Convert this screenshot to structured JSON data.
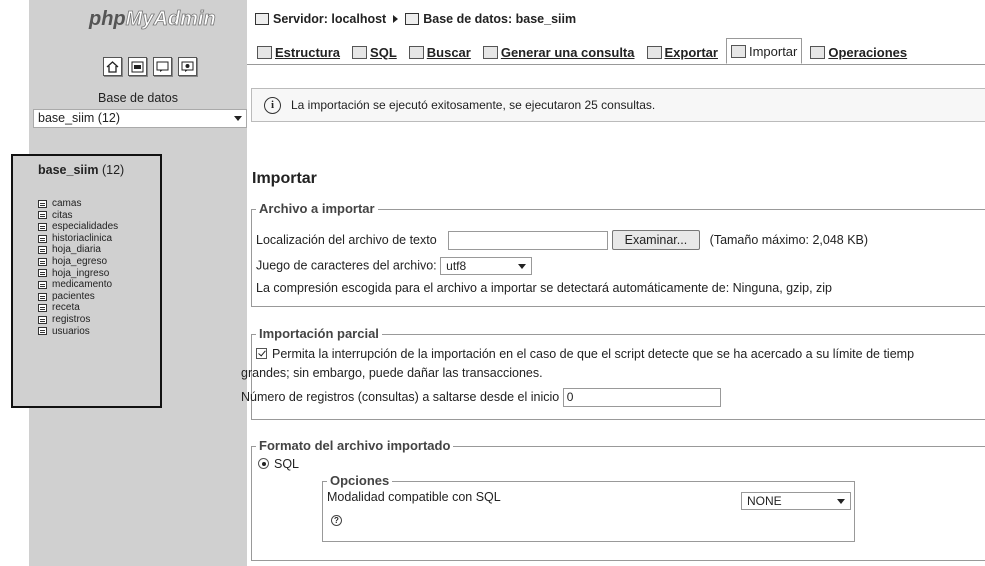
{
  "sidebar": {
    "logo_php": "php",
    "logo_my": "MyAdmin",
    "icon_buttons": [
      "home-icon",
      "sql-icon",
      "help-icon",
      "query-window-icon"
    ],
    "db_label": "Base de datos",
    "db_select_value": "base_siim (12)",
    "db_name": "base_siim",
    "db_count": "(12)",
    "tables": [
      "camas",
      "citas",
      "especialidades",
      "historiaclinica",
      "hoja_diaria",
      "hoja_egreso",
      "hoja_ingreso",
      "medicamento",
      "pacientes",
      "receta",
      "registros",
      "usuarios"
    ]
  },
  "breadcrumb": {
    "server": "Servidor: localhost",
    "database": "Base de datos: base_siim"
  },
  "tabs": [
    "Estructura",
    "SQL",
    "Buscar",
    "Generar una consulta",
    "Exportar",
    "Importar",
    "Operaciones"
  ],
  "active_tab": "Importar",
  "notice": "La importación se ejecutó exitosamente, se ejecutaron 25 consultas.",
  "heading": "Importar",
  "archivo": {
    "legend": "Archivo a importar",
    "location_label": "Localización del archivo de texto",
    "browse_button": "Examinar...",
    "max_size": "(Tamaño máximo: 2,048 KB)",
    "charset_label": "Juego de caracteres del archivo:",
    "charset_value": "utf8",
    "compression_text": "La compresión escogida para el archivo a importar se detectará automáticamente de: Ninguna, gzip, zip"
  },
  "parcial": {
    "legend": "Importación parcial",
    "allow_interrupt_line1": "Permita la interrupción de la importación en el caso de que el script detecte que se ha acercado a su límite de tiemp",
    "allow_interrupt_line2": "grandes; sin embargo, puede dañar las transacciones.",
    "skip_label": "Número de registros (consultas) a saltarse desde el inicio",
    "skip_value": "0"
  },
  "formato": {
    "legend": "Formato del archivo importado",
    "format_option": "SQL",
    "options_legend": "Opciones",
    "compat_label": "Modalidad compatible con SQL",
    "compat_value": "NONE"
  },
  "colors": {
    "sidebar_bg": "#d0d0d0",
    "highlight_border": "#111111"
  }
}
